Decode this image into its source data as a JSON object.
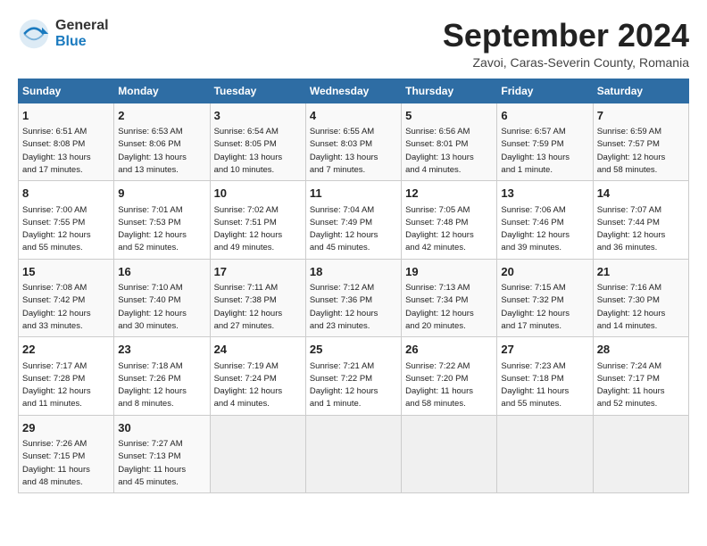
{
  "header": {
    "logo_general": "General",
    "logo_blue": "Blue",
    "month_title": "September 2024",
    "location": "Zavoi, Caras-Severin County, Romania"
  },
  "days_of_week": [
    "Sunday",
    "Monday",
    "Tuesday",
    "Wednesday",
    "Thursday",
    "Friday",
    "Saturday"
  ],
  "weeks": [
    [
      {
        "day": "1",
        "content": "Sunrise: 6:51 AM\nSunset: 8:08 PM\nDaylight: 13 hours\nand 17 minutes."
      },
      {
        "day": "2",
        "content": "Sunrise: 6:53 AM\nSunset: 8:06 PM\nDaylight: 13 hours\nand 13 minutes."
      },
      {
        "day": "3",
        "content": "Sunrise: 6:54 AM\nSunset: 8:05 PM\nDaylight: 13 hours\nand 10 minutes."
      },
      {
        "day": "4",
        "content": "Sunrise: 6:55 AM\nSunset: 8:03 PM\nDaylight: 13 hours\nand 7 minutes."
      },
      {
        "day": "5",
        "content": "Sunrise: 6:56 AM\nSunset: 8:01 PM\nDaylight: 13 hours\nand 4 minutes."
      },
      {
        "day": "6",
        "content": "Sunrise: 6:57 AM\nSunset: 7:59 PM\nDaylight: 13 hours\nand 1 minute."
      },
      {
        "day": "7",
        "content": "Sunrise: 6:59 AM\nSunset: 7:57 PM\nDaylight: 12 hours\nand 58 minutes."
      }
    ],
    [
      {
        "day": "8",
        "content": "Sunrise: 7:00 AM\nSunset: 7:55 PM\nDaylight: 12 hours\nand 55 minutes."
      },
      {
        "day": "9",
        "content": "Sunrise: 7:01 AM\nSunset: 7:53 PM\nDaylight: 12 hours\nand 52 minutes."
      },
      {
        "day": "10",
        "content": "Sunrise: 7:02 AM\nSunset: 7:51 PM\nDaylight: 12 hours\nand 49 minutes."
      },
      {
        "day": "11",
        "content": "Sunrise: 7:04 AM\nSunset: 7:49 PM\nDaylight: 12 hours\nand 45 minutes."
      },
      {
        "day": "12",
        "content": "Sunrise: 7:05 AM\nSunset: 7:48 PM\nDaylight: 12 hours\nand 42 minutes."
      },
      {
        "day": "13",
        "content": "Sunrise: 7:06 AM\nSunset: 7:46 PM\nDaylight: 12 hours\nand 39 minutes."
      },
      {
        "day": "14",
        "content": "Sunrise: 7:07 AM\nSunset: 7:44 PM\nDaylight: 12 hours\nand 36 minutes."
      }
    ],
    [
      {
        "day": "15",
        "content": "Sunrise: 7:08 AM\nSunset: 7:42 PM\nDaylight: 12 hours\nand 33 minutes."
      },
      {
        "day": "16",
        "content": "Sunrise: 7:10 AM\nSunset: 7:40 PM\nDaylight: 12 hours\nand 30 minutes."
      },
      {
        "day": "17",
        "content": "Sunrise: 7:11 AM\nSunset: 7:38 PM\nDaylight: 12 hours\nand 27 minutes."
      },
      {
        "day": "18",
        "content": "Sunrise: 7:12 AM\nSunset: 7:36 PM\nDaylight: 12 hours\nand 23 minutes."
      },
      {
        "day": "19",
        "content": "Sunrise: 7:13 AM\nSunset: 7:34 PM\nDaylight: 12 hours\nand 20 minutes."
      },
      {
        "day": "20",
        "content": "Sunrise: 7:15 AM\nSunset: 7:32 PM\nDaylight: 12 hours\nand 17 minutes."
      },
      {
        "day": "21",
        "content": "Sunrise: 7:16 AM\nSunset: 7:30 PM\nDaylight: 12 hours\nand 14 minutes."
      }
    ],
    [
      {
        "day": "22",
        "content": "Sunrise: 7:17 AM\nSunset: 7:28 PM\nDaylight: 12 hours\nand 11 minutes."
      },
      {
        "day": "23",
        "content": "Sunrise: 7:18 AM\nSunset: 7:26 PM\nDaylight: 12 hours\nand 8 minutes."
      },
      {
        "day": "24",
        "content": "Sunrise: 7:19 AM\nSunset: 7:24 PM\nDaylight: 12 hours\nand 4 minutes."
      },
      {
        "day": "25",
        "content": "Sunrise: 7:21 AM\nSunset: 7:22 PM\nDaylight: 12 hours\nand 1 minute."
      },
      {
        "day": "26",
        "content": "Sunrise: 7:22 AM\nSunset: 7:20 PM\nDaylight: 11 hours\nand 58 minutes."
      },
      {
        "day": "27",
        "content": "Sunrise: 7:23 AM\nSunset: 7:18 PM\nDaylight: 11 hours\nand 55 minutes."
      },
      {
        "day": "28",
        "content": "Sunrise: 7:24 AM\nSunset: 7:17 PM\nDaylight: 11 hours\nand 52 minutes."
      }
    ],
    [
      {
        "day": "29",
        "content": "Sunrise: 7:26 AM\nSunset: 7:15 PM\nDaylight: 11 hours\nand 48 minutes."
      },
      {
        "day": "30",
        "content": "Sunrise: 7:27 AM\nSunset: 7:13 PM\nDaylight: 11 hours\nand 45 minutes."
      },
      {
        "day": "",
        "content": ""
      },
      {
        "day": "",
        "content": ""
      },
      {
        "day": "",
        "content": ""
      },
      {
        "day": "",
        "content": ""
      },
      {
        "day": "",
        "content": ""
      }
    ]
  ]
}
